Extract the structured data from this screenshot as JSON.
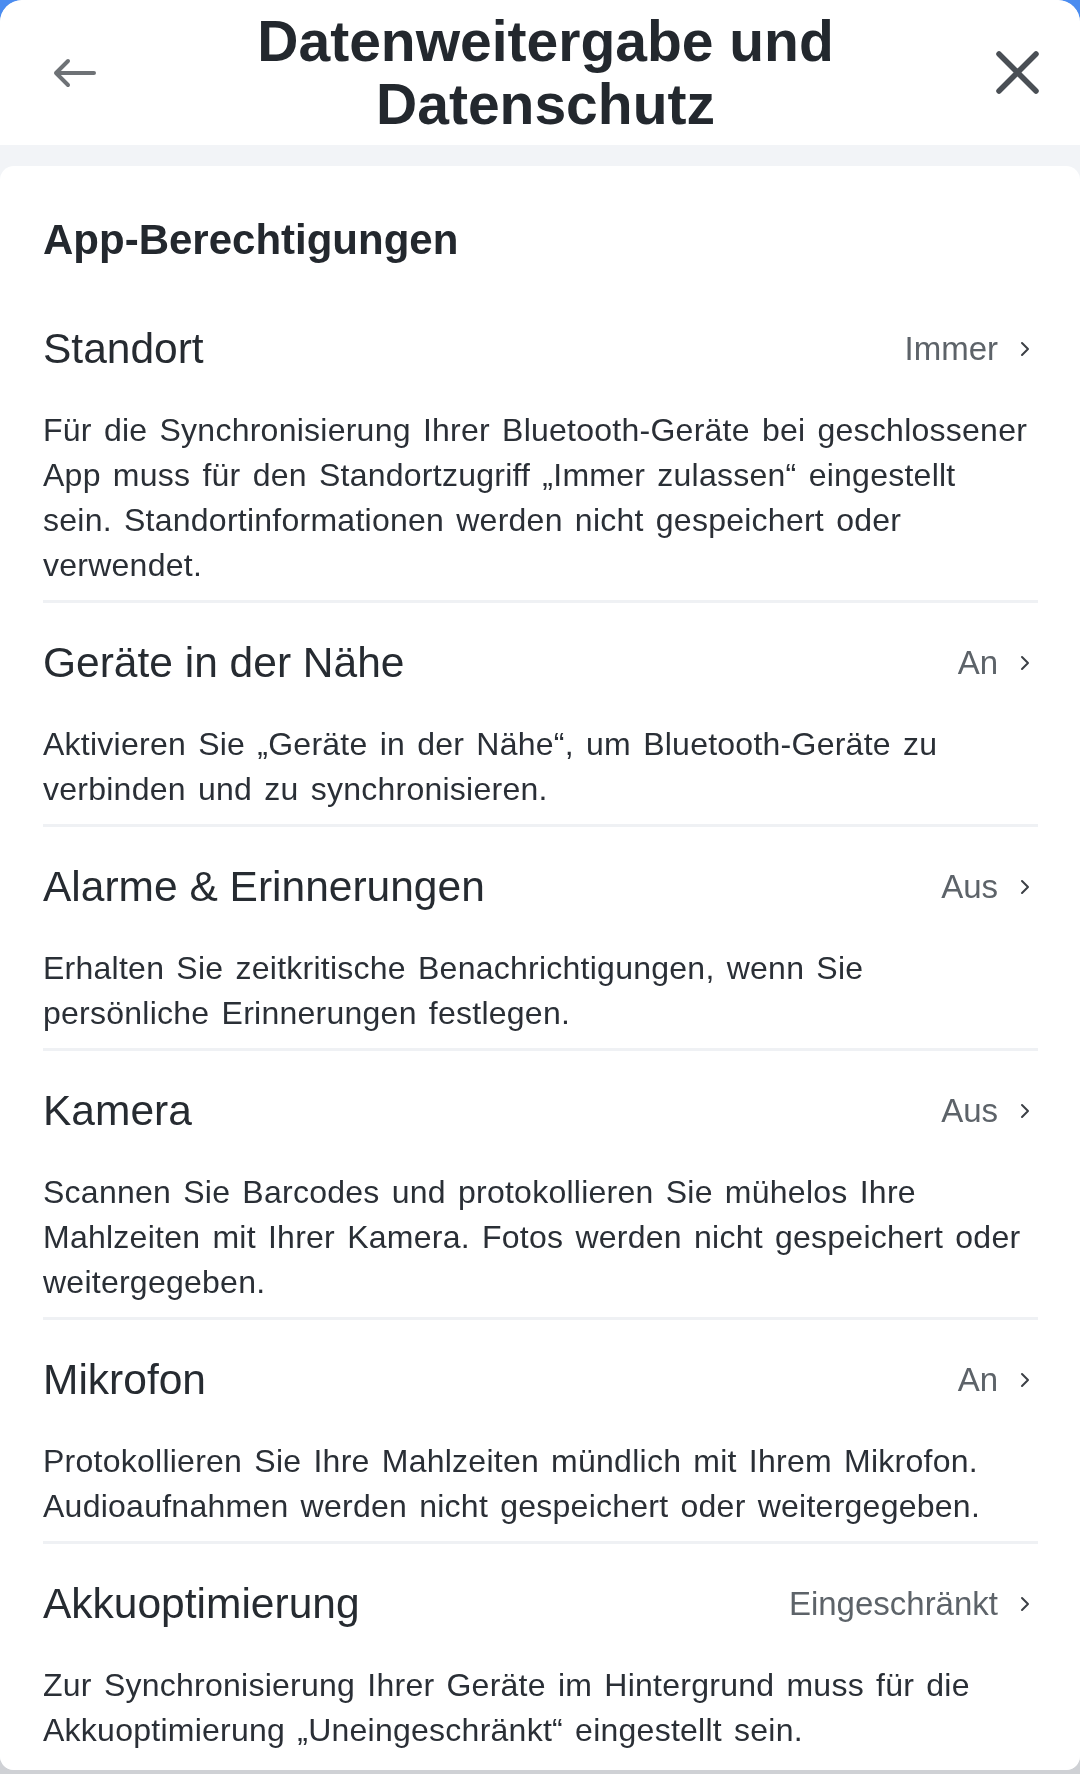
{
  "header": {
    "title": "Datenweitergabe und Datenschutz"
  },
  "section": {
    "heading": "App-Berechtigungen",
    "items": [
      {
        "title": "Standort",
        "value": "Immer",
        "description": "Für die Synchronisierung Ihrer Bluetooth-Geräte bei geschlossener App muss für den Standortzugriff „Immer zulassen“ eingestellt sein. Standortinformationen werden nicht gespeichert oder verwendet."
      },
      {
        "title": "Geräte in der Nähe",
        "value": "An",
        "description": "Aktivieren Sie „Geräte in der Nähe“, um Bluetooth-Geräte zu verbinden und zu synchronisieren."
      },
      {
        "title": "Alarme & Erinnerungen",
        "value": "Aus",
        "description": "Erhalten Sie zeitkritische Benachrichtigungen, wenn Sie persönliche Erinnerungen festlegen."
      },
      {
        "title": "Kamera",
        "value": "Aus",
        "description": "Scannen Sie Barcodes und protokollieren Sie mühelos Ihre Mahlzeiten mit Ihrer Kamera. Fotos werden nicht gespeichert oder weitergegeben."
      },
      {
        "title": "Mikrofon",
        "value": "An",
        "description": "Protokollieren Sie Ihre Mahlzeiten mündlich mit Ihrem Mikrofon. Audioaufnahmen werden nicht gespeichert oder weitergegeben."
      },
      {
        "title": "Akkuoptimierung",
        "value": "Eingeschränkt",
        "description": "Zur Synchronisierung Ihrer Geräte im Hintergrund muss für die Akkuoptimierung „Uneingeschränkt“ eingestellt sein."
      }
    ]
  }
}
